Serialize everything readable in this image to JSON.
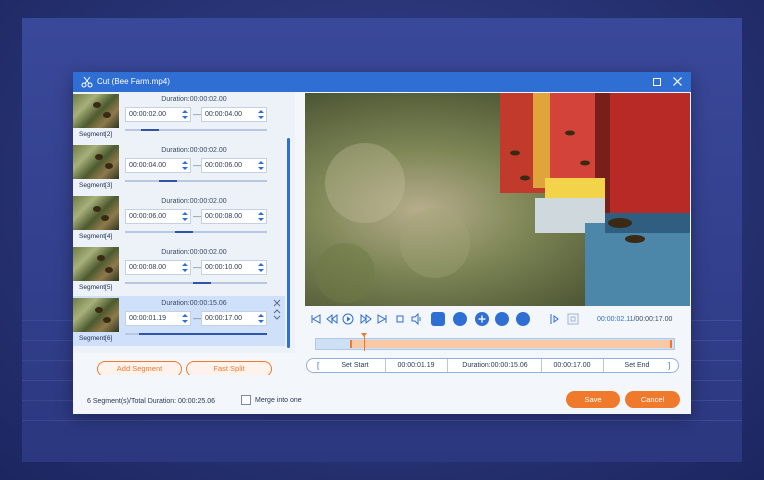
{
  "window": {
    "title": "Cut (Bee Farm.mp4)"
  },
  "segments": [
    {
      "label": "Segment[2]",
      "duration": "Duration:00:00:02.00",
      "start": "00:00:02.00",
      "end": "00:00:04.00"
    },
    {
      "label": "Segment[3]",
      "duration": "Duration:00:00:02.00",
      "start": "00:00:04.00",
      "end": "00:00:06.00"
    },
    {
      "label": "Segment[4]",
      "duration": "Duration:00:00:02.00",
      "start": "00:00:06.00",
      "end": "00:00:08.00"
    },
    {
      "label": "Segment[5]",
      "duration": "Duration:00:00:02.00",
      "start": "00:00:08.00",
      "end": "00:00:10.00"
    },
    {
      "label": "Segment[6]",
      "duration": "Duration:00:00:15.06",
      "start": "00:00:01.19",
      "end": "00:00:17.00"
    }
  ],
  "actions": {
    "add_segment": "Add Segment",
    "fast_split": "Fast Split"
  },
  "player": {
    "current_time": "00:00:02.11",
    "total_time": "/00:00:17.00"
  },
  "setbar": {
    "set_start": "Set Start",
    "start_value": "00:00:01.19",
    "duration": "Duration:00:00:15.06",
    "end_value": "00:00:17.00",
    "set_end": "Set End",
    "bracket_left": "[",
    "bracket_right": "]"
  },
  "footer": {
    "summary": "6 Segment(s)/Total Duration: 00:00:25.06",
    "merge_label": "Merge into one",
    "save": "Save",
    "cancel": "Cancel"
  },
  "colors": {
    "accent": "#2f6fd4",
    "orange": "#f07a2b",
    "selected": "#cfe0fa"
  }
}
